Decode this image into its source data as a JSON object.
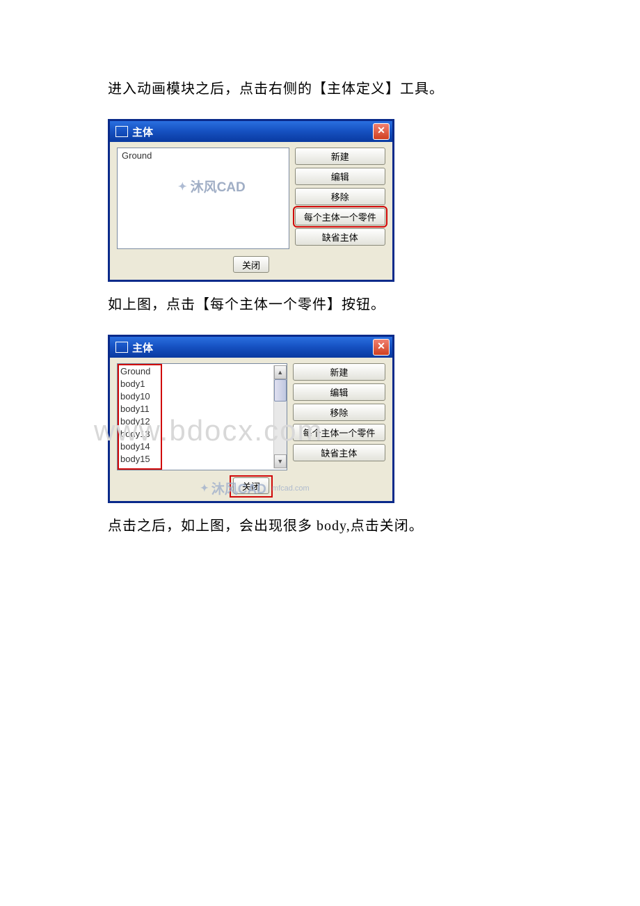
{
  "text": {
    "para1": "进入动画模块之后，点击右侧的【主体定义】工具。",
    "para2": "如上图，点击【每个主体一个零件】按钮。",
    "para3": "点击之后，如上图，会出现很多 body,点击关闭。"
  },
  "dialog1": {
    "title": "主体",
    "list": [
      "Ground"
    ],
    "buttons": {
      "new": "新建",
      "edit": "编辑",
      "remove": "移除",
      "one_per": "每个主体一个零件",
      "default": "缺省主体"
    },
    "close_btn": "关闭"
  },
  "dialog2": {
    "title": "主体",
    "list": [
      "Ground",
      "body1",
      "body10",
      "body11",
      "body12",
      "body13",
      "body14",
      "body15"
    ],
    "buttons": {
      "new": "新建",
      "edit": "编辑",
      "remove": "移除",
      "one_per": "每个主体一个零件",
      "default": "缺省主体"
    },
    "close_btn": "关闭"
  },
  "watermarks": {
    "cad1": "沐风CAD",
    "cad2": "沐风CAD",
    "cad2_sub": "mfcad.com",
    "bdocx": "www.bdocx.com"
  }
}
